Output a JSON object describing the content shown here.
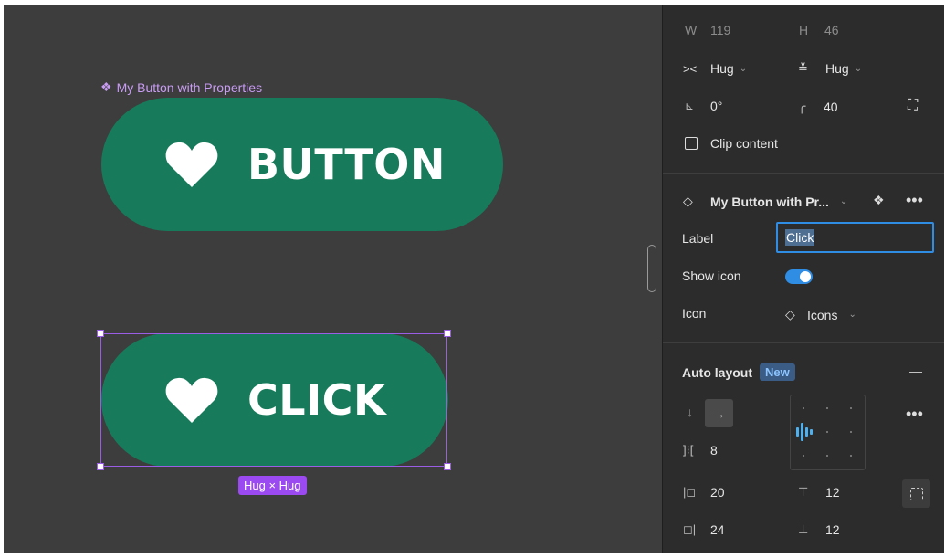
{
  "canvas": {
    "component_label": "My Button with Properties",
    "button1_text": "BUTTON",
    "button2_text": "CLICK",
    "size_tag": "Hug × Hug",
    "button_color": "#177b5b",
    "selection_color": "#9b5de5"
  },
  "panel": {
    "w_label": "W",
    "w_value": "119",
    "h_label": "H",
    "h_value": "46",
    "hsize": "Hug",
    "vsize": "Hug",
    "rotation": "0°",
    "radius": "40",
    "clip_content": "Clip content",
    "component_name": "My Button with Pr...",
    "label_prop": "Label",
    "label_value": "Click",
    "show_icon_prop": "Show icon",
    "icon_prop": "Icon",
    "icon_value": "Icons",
    "auto_layout": "Auto layout",
    "new_badge": "New",
    "gap": "8",
    "pad_left": "20",
    "pad_top": "12",
    "pad_right": "24",
    "pad_bottom": "12"
  }
}
